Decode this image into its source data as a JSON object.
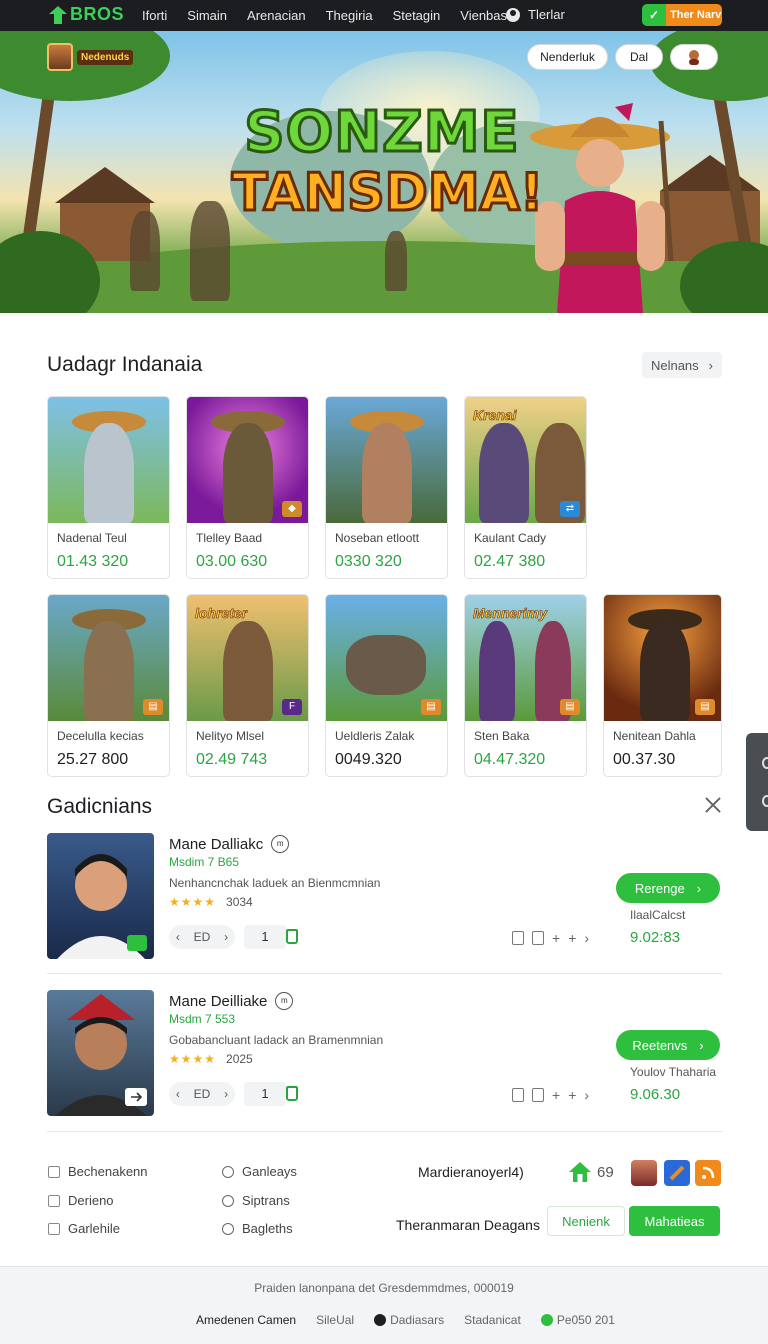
{
  "nav": {
    "logo": "BROS",
    "links": [
      "Iforti",
      "Simain",
      "Arenacian",
      "Thegiria",
      "Stetagin",
      "Vienbass"
    ],
    "user": "Tlerlar",
    "cta": "Ther Narv"
  },
  "hero": {
    "badge_text": "Nedenuds",
    "btn1": "Nenderluk",
    "btn2": "Dal",
    "title_line1": "SONZME",
    "title_line2": "TANSDMA!"
  },
  "section1": {
    "title": "Uadagr Indanaia",
    "more": "Nelnans"
  },
  "games": [
    {
      "name": "Nadenal Teul",
      "price": "01.43 320",
      "accent": "#2aa640"
    },
    {
      "name": "Tlelley Baad",
      "price": "03.00 630",
      "accent": "#2aa640"
    },
    {
      "name": "Noseban etloott",
      "price": "0330 320",
      "accent": "#2aa640"
    },
    {
      "name": "Kaulant Cady",
      "price": "02.47 380",
      "accent": "#2aa640",
      "caption": "Krenai"
    },
    {
      "name": "Decelulla kecias",
      "price": "25.27 800",
      "accent": "#1d1f23"
    },
    {
      "name": "Nelityo Mlsel",
      "price": "02.49 743",
      "accent": "#2aa640",
      "caption": "lohreter"
    },
    {
      "name": "Ueldleris Zalak",
      "price": "0049.320",
      "accent": "#1d1f23"
    },
    {
      "name": "Sten Baka",
      "price": "04.47.320",
      "accent": "#2aa640",
      "caption": "Mennerimy"
    },
    {
      "name": "Nenitean Dahla",
      "price": "00.37.30",
      "accent": "#1d1f23"
    }
  ],
  "section2": {
    "title": "Gadicnians"
  },
  "items": [
    {
      "name": "Mane Dalliakc",
      "sub": "Msdim 7 B65",
      "desc": "Nenhancnchak laduek an Bienmcmnian",
      "stars": "★★★★",
      "rating": "3034",
      "ctrl": "ED",
      "qty": "1",
      "action": "Rerenge",
      "plabel": "IlaalCalcst",
      "price": "9.02:83"
    },
    {
      "name": "Mane Deilliake",
      "sub": "Msdm 7 553",
      "desc": "Gobabancluant ladack an Bramenmnian",
      "stars": "★★★★",
      "rating": "2025",
      "ctrl": "ED",
      "qty": "1",
      "action": "Reetenvs",
      "plabel": "Youlov Thaharia",
      "price": "9.06.30"
    }
  ],
  "footer": {
    "col1": [
      "Bechenakenn",
      "Derieno",
      "Garlehile"
    ],
    "col2": [
      "Ganleays",
      "Siptrans",
      "Bagleths"
    ],
    "headline": "Mardieranoyerl4)",
    "count": "69",
    "subline": "Theranmaran Deagans",
    "btn_outline": "Nenienk",
    "btn_solid": "Mahatieas"
  },
  "bottom": {
    "copyright": "Praiden lanonpana det Gresdemmdmes, 000019",
    "links": [
      "Amedenen Camen",
      "SileUal",
      "Dadiasars",
      "Stadanicat",
      "Pe050 201"
    ]
  }
}
